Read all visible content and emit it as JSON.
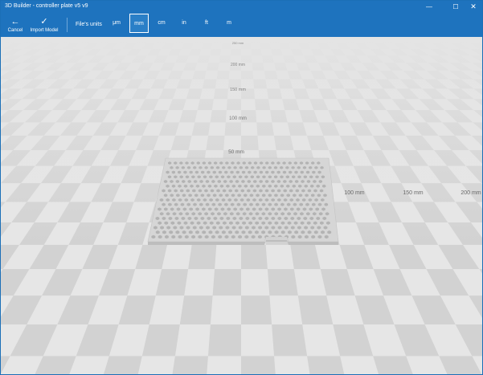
{
  "window": {
    "title": "3D Builder - controller plate v5 v9",
    "minimize_glyph": "—",
    "maximize_glyph": "☐",
    "close_glyph": "✕"
  },
  "toolbar": {
    "cancel": {
      "label": "Cancel",
      "icon": "arrow-left-icon",
      "glyph": "←"
    },
    "import": {
      "label": "Import Model",
      "icon": "checkmark-icon",
      "glyph": "✓"
    },
    "units_label": "File's units",
    "units": [
      {
        "label": "μm",
        "selected": false
      },
      {
        "label": "mm",
        "selected": true
      },
      {
        "label": "cm",
        "selected": false
      },
      {
        "label": "in",
        "selected": false
      },
      {
        "label": "ft",
        "selected": false
      },
      {
        "label": "m",
        "selected": false
      }
    ]
  },
  "viewport": {
    "vertical_scale": [
      "250 mm",
      "200 mm",
      "150 mm",
      "100 mm",
      "50 mm"
    ],
    "horizontal_scale": [
      "100 mm",
      "150 mm",
      "200 mm"
    ],
    "colors": {
      "floor_light": "#e6e6e6",
      "floor_dark": "#d2d2d2",
      "model": "#d6d6d6",
      "model_hole": "#b3b3b3",
      "accent": "#1e73be"
    }
  }
}
